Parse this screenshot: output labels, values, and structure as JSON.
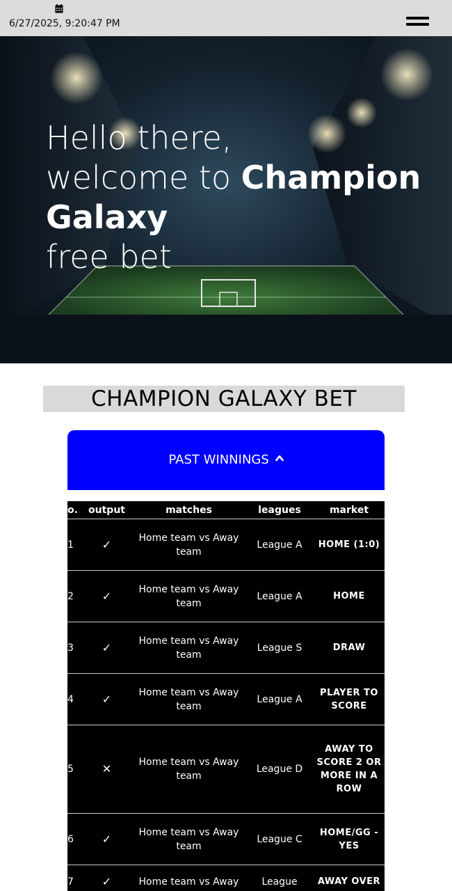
{
  "header": {
    "datetime": "6/27/2025, 9:20:47 PM",
    "calendar_icon": "calendar-icon",
    "menu_icon": "hamburger-menu-icon"
  },
  "hero": {
    "line1": "Hello there,",
    "line2_prefix": "welcome to ",
    "brand_part1": "Champion",
    "brand_part2": "Galaxy",
    "line4": "free bet"
  },
  "section": {
    "title": "CHAMPION GALAXY BET"
  },
  "past_winnings": {
    "label": "PAST WINNINGS",
    "icon": "chevron-up-icon",
    "accent_color": "#0000ff"
  },
  "table": {
    "headers": [
      "o.",
      "output",
      "matches",
      "leagues",
      "market"
    ],
    "rows": [
      {
        "no": "1",
        "output": "✓",
        "match": "Home team vs Away team",
        "league": "League A",
        "market": "HOME (1:0)"
      },
      {
        "no": "2",
        "output": "✓",
        "match": "Home team vs Away team",
        "league": "League A",
        "market": "HOME"
      },
      {
        "no": "3",
        "output": "✓",
        "match": "Home team vs Away team",
        "league": "League S",
        "market": "DRAW"
      },
      {
        "no": "4",
        "output": "✓",
        "match": "Home team vs Away team",
        "league": "League A",
        "market": "PLAYER TO SCORE"
      },
      {
        "no": "5",
        "output": "✕",
        "match": "Home team vs Away team",
        "league": "League D",
        "market": "AWAY TO SCORE 2 OR MORE IN A ROW"
      },
      {
        "no": "6",
        "output": "✓",
        "match": "Home team vs Away team",
        "league": "League C",
        "market": "HOME/GG - YES"
      },
      {
        "no": "7",
        "output": "✓",
        "match": "Home team vs Away",
        "league": "League",
        "market": "AWAY OVER"
      }
    ]
  }
}
